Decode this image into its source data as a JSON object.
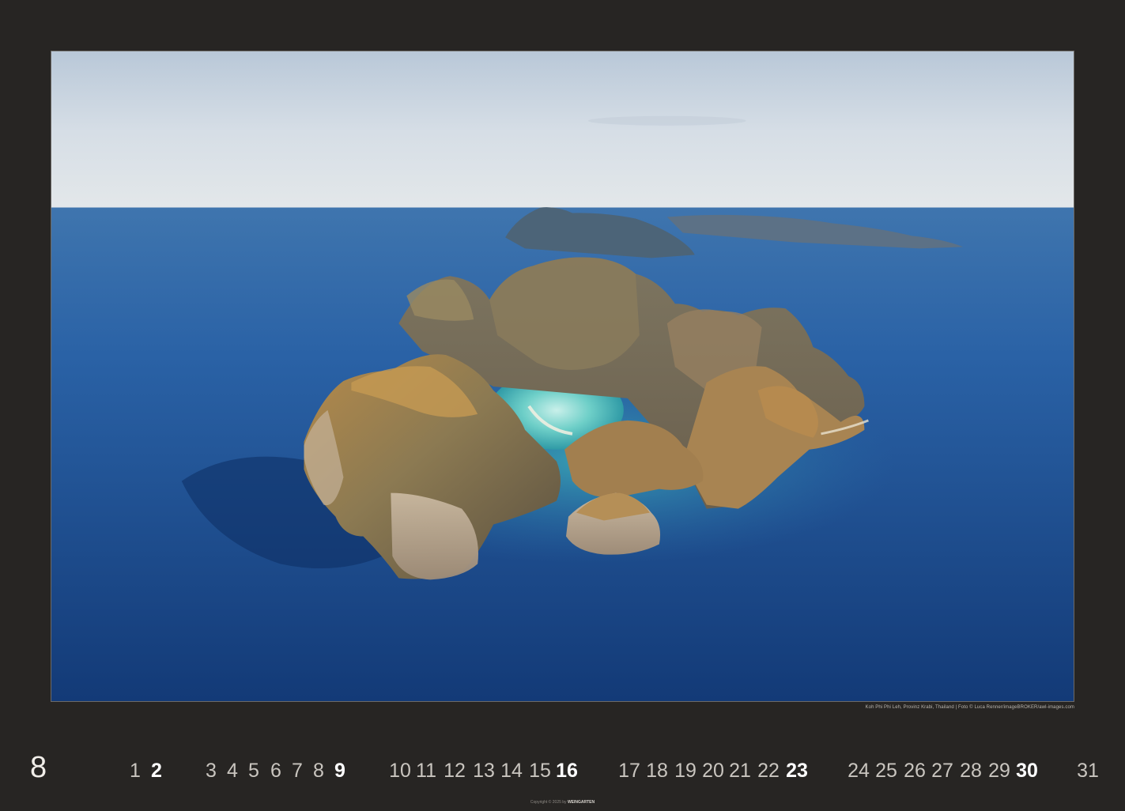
{
  "calendar": {
    "month": "8",
    "days": [
      {
        "n": "1",
        "sunday": false
      },
      {
        "n": "2",
        "sunday": true
      },
      {
        "n": "3",
        "sunday": false
      },
      {
        "n": "4",
        "sunday": false
      },
      {
        "n": "5",
        "sunday": false
      },
      {
        "n": "6",
        "sunday": false
      },
      {
        "n": "7",
        "sunday": false
      },
      {
        "n": "8",
        "sunday": false
      },
      {
        "n": "9",
        "sunday": true
      },
      {
        "n": "10",
        "sunday": false
      },
      {
        "n": "11",
        "sunday": false
      },
      {
        "n": "12",
        "sunday": false
      },
      {
        "n": "13",
        "sunday": false
      },
      {
        "n": "14",
        "sunday": false
      },
      {
        "n": "15",
        "sunday": false
      },
      {
        "n": "16",
        "sunday": true
      },
      {
        "n": "17",
        "sunday": false
      },
      {
        "n": "18",
        "sunday": false
      },
      {
        "n": "19",
        "sunday": false
      },
      {
        "n": "20",
        "sunday": false
      },
      {
        "n": "21",
        "sunday": false
      },
      {
        "n": "22",
        "sunday": false
      },
      {
        "n": "23",
        "sunday": true
      },
      {
        "n": "24",
        "sunday": false
      },
      {
        "n": "25",
        "sunday": false
      },
      {
        "n": "26",
        "sunday": false
      },
      {
        "n": "27",
        "sunday": false
      },
      {
        "n": "28",
        "sunday": false
      },
      {
        "n": "29",
        "sunday": false
      },
      {
        "n": "30",
        "sunday": true
      },
      {
        "n": "31",
        "sunday": false
      }
    ]
  },
  "photo": {
    "caption": "Koh Phi Phi Leh, Provinz Krabi, Thailand | Foto © Luca Renner/imageBROKER/awl-images.com"
  },
  "footer": {
    "copyright": "Copyright © 2025 by ",
    "brand": "WEINGARTEN"
  },
  "colors": {
    "background": "#272523",
    "sky": "#dfe6ec",
    "sea": "#1f4f93",
    "lagoon": "#5fc4c0",
    "sunday": "#ffffff"
  }
}
